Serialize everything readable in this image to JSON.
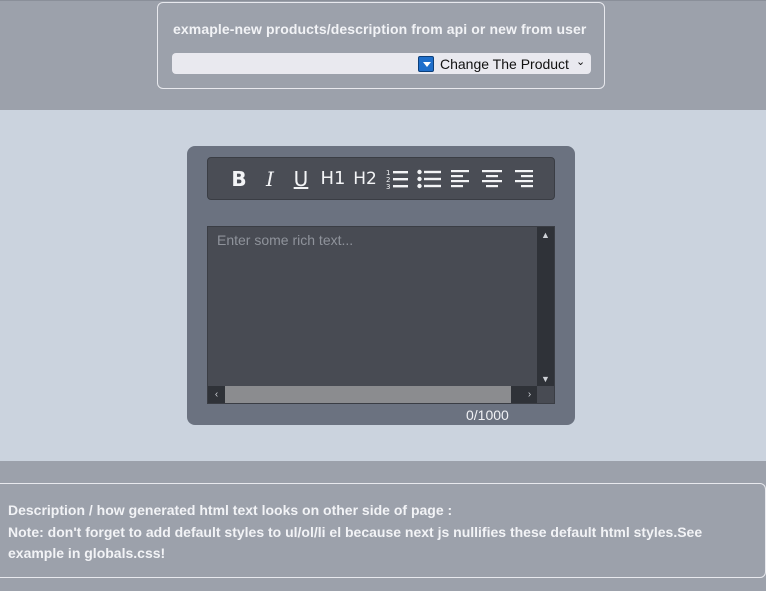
{
  "product_panel": {
    "title": "exmaple-new products/description from api or new from user",
    "select_label": "Change The Product",
    "chevron": "⌄"
  },
  "toolbar": {
    "bold": "B",
    "italic": "I",
    "underline": "U",
    "h1": "H1",
    "h2": "H2",
    "icons": [
      "bold-icon",
      "italic-icon",
      "underline-icon",
      "heading-1-icon",
      "heading-2-icon",
      "ordered-list-icon",
      "unordered-list-icon",
      "align-left-icon",
      "align-center-icon",
      "align-right-icon"
    ]
  },
  "editor": {
    "placeholder": "Enter some rich text...",
    "char_count": "0/1000"
  },
  "description": {
    "heading": "Description / how generated html text looks on other side of page :",
    "note": "Note: don't forget to add default styles to ul/ol/li el because next js nullifies these default html styles.See example in globals.css!"
  },
  "colors": {
    "page_background": "#9ca1ab",
    "editor_area_background": "#cbd3de",
    "editor_card": "#6b7280",
    "toolbar": "#4a4d55",
    "text_area": "#484b53"
  }
}
